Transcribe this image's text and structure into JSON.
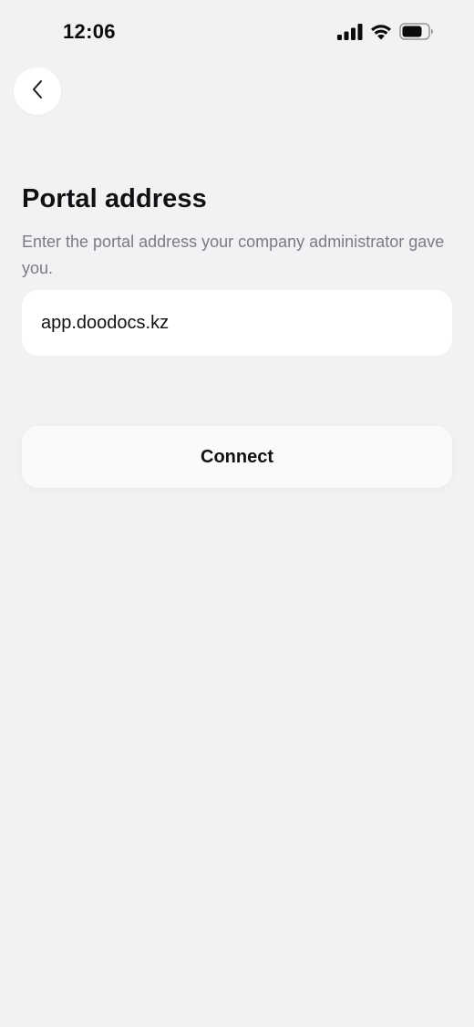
{
  "status_bar": {
    "time": "12:06",
    "icons": [
      "cellular-signal-icon",
      "wifi-icon",
      "battery-icon"
    ]
  },
  "header": {
    "back_icon": "chevron-left-icon"
  },
  "main": {
    "title": "Portal address",
    "subtitle": "Enter the portal address your company administrator gave you.",
    "address_field": {
      "value": "app.doodocs.kz"
    },
    "connect_label": "Connect"
  },
  "colors": {
    "background": "#f2f2f4",
    "card": "#ffffff",
    "title": "#111114",
    "subtitle": "#7b7b82"
  }
}
